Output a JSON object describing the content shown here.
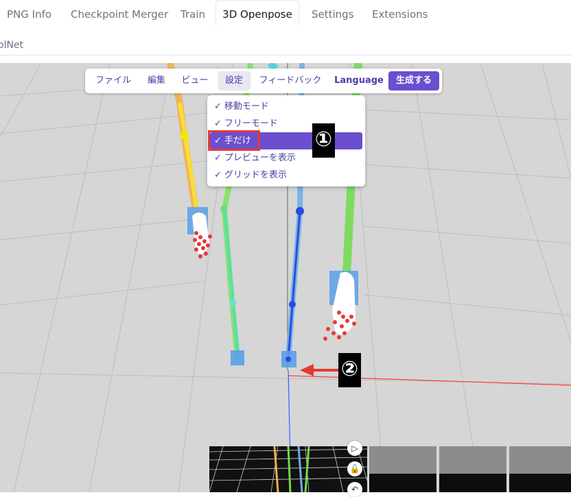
{
  "tabs": [
    {
      "label": "PNG Info"
    },
    {
      "label": "Checkpoint Merger"
    },
    {
      "label": "Train"
    },
    {
      "label": "3D Openpose"
    },
    {
      "label": "Settings"
    },
    {
      "label": "Extensions"
    }
  ],
  "subtab": {
    "label": "olNet"
  },
  "menubar": {
    "items": [
      {
        "label": "ファイル"
      },
      {
        "label": "編集"
      },
      {
        "label": "ビュー"
      },
      {
        "label": "設定"
      },
      {
        "label": "フィードバック"
      },
      {
        "label": "Language"
      },
      {
        "label": "生成する"
      }
    ]
  },
  "dropdown": {
    "check": "✓",
    "items": [
      {
        "label": "移動モード"
      },
      {
        "label": "フリーモード"
      },
      {
        "label": "手だけ"
      },
      {
        "label": "プレビューを表示"
      },
      {
        "label": "グリッドを表示"
      }
    ]
  },
  "annotations": {
    "badge1": "①",
    "badge2": "②"
  },
  "colors": {
    "accent": "#6b4fcf",
    "annotation_red": "#e53935"
  }
}
